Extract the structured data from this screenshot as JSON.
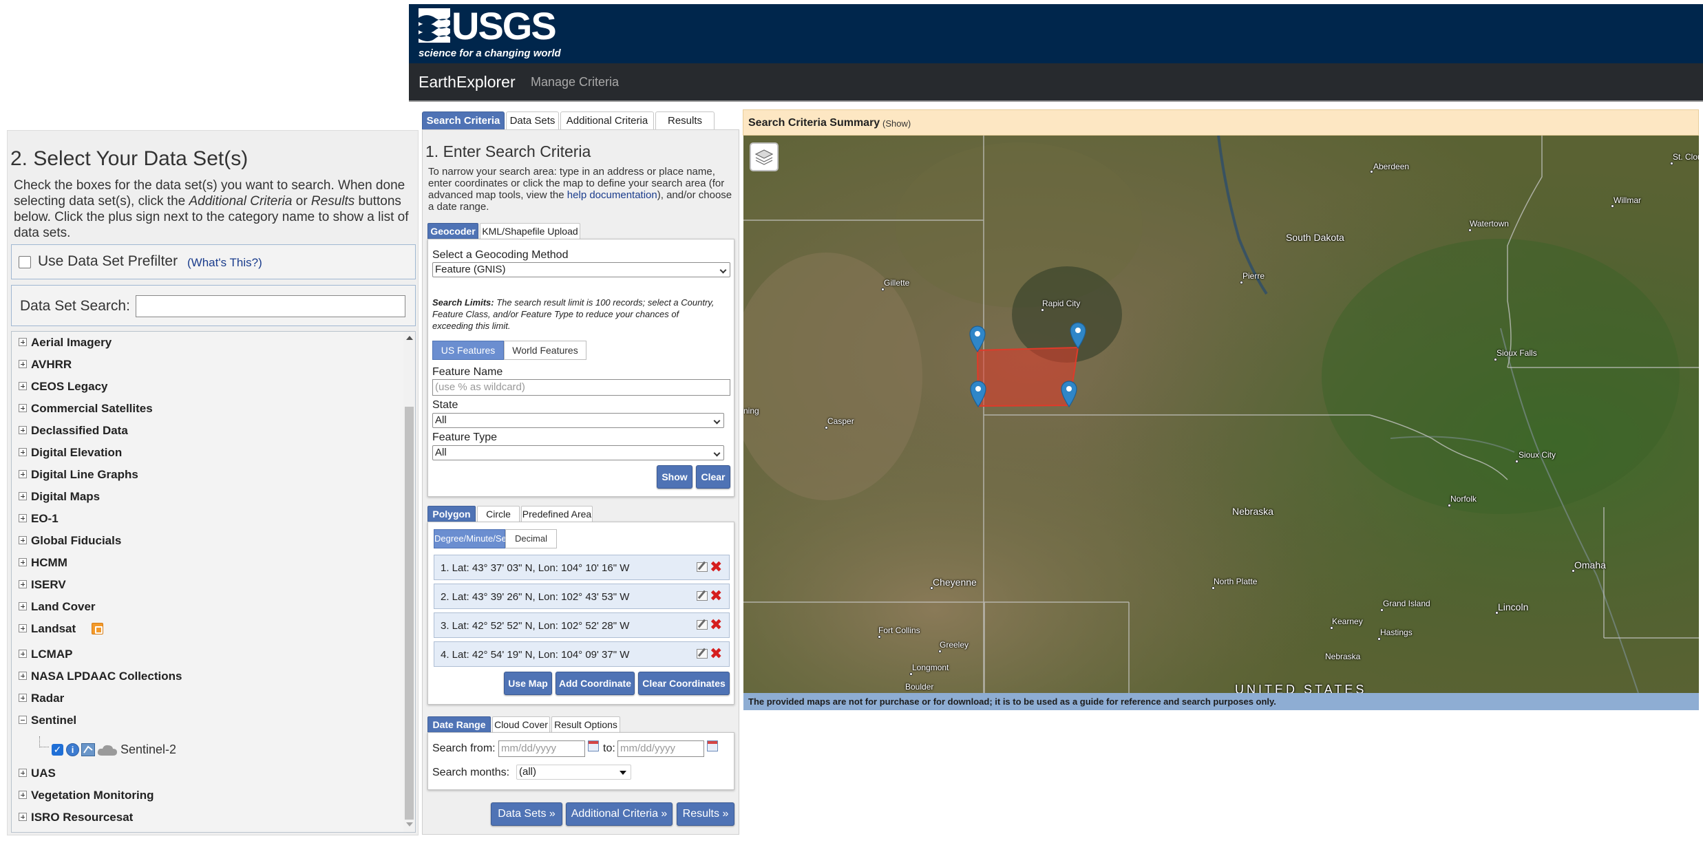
{
  "header": {
    "usgs_word": "USGS",
    "usgs_tagline": "science for a changing world",
    "app_name": "EarthExplorer",
    "manage_criteria": "Manage Criteria"
  },
  "main_tabs": [
    "Search Criteria",
    "Data Sets",
    "Additional Criteria",
    "Results"
  ],
  "datasets_panel": {
    "title": "2. Select Your Data Set(s)",
    "instructions_1": "Check the boxes for the data set(s) you want to search. When done selecting data set(s), click the ",
    "instructions_em1": "Additional Criteria",
    "instructions_2": " or ",
    "instructions_em2": "Results",
    "instructions_3": " buttons below. Click the plus sign next to the category name to show a list of data sets.",
    "prefilter_label": "Use Data Set Prefilter",
    "prefilter_link": "(What's This?)",
    "search_label": "Data Set Search:",
    "categories": [
      "Aerial Imagery",
      "AVHRR",
      "CEOS Legacy",
      "Commercial Satellites",
      "Declassified Data",
      "Digital Elevation",
      "Digital Line Graphs",
      "Digital Maps",
      "EO-1",
      "Global Fiducials",
      "HCMM",
      "ISERV",
      "Land Cover",
      "Landsat",
      "LCMAP",
      "NASA LPDAAC Collections",
      "Radar",
      "Sentinel",
      "UAS",
      "Vegetation Monitoring",
      "ISRO Resourcesat"
    ],
    "sentinel_child": "Sentinel-2"
  },
  "criteria": {
    "title": "1. Enter Search Criteria",
    "desc_1": "To narrow your search area: type in an address or place name, enter coordinates or click the map to define your search area (for advanced map tools, view the ",
    "desc_link": "help documentation",
    "desc_2": "), and/or choose a date range.",
    "geo_tabs": [
      "Geocoder",
      "KML/Shapefile Upload"
    ],
    "geocoding_method_label": "Select a Geocoding Method",
    "geocoding_method_value": "Feature (GNIS)",
    "search_limits_bold": "Search Limits:",
    "search_limits_text": " The search result limit is 100 records; select a Country, Feature Class, and/or Feature Type to reduce your chances of exceeding this limit.",
    "feature_toggle": [
      "US Features",
      "World Features"
    ],
    "feature_name_label": "Feature Name",
    "feature_name_placeholder": "(use % as wildcard)",
    "state_label": "State",
    "state_value": "All",
    "feature_type_label": "Feature Type",
    "feature_type_value": "All",
    "show_button": "Show",
    "clear_button": "Clear",
    "area_tabs": [
      "Polygon",
      "Circle",
      "Predefined Area"
    ],
    "coord_toggle": [
      "Degree/Minute/Second",
      "Decimal"
    ],
    "coordinates": [
      "1.  Lat: 43° 37' 03\" N, Lon: 104° 10' 16\" W",
      "2.  Lat: 43° 39' 26\" N, Lon: 102° 43' 53\" W",
      "3.  Lat: 42° 52' 52\" N, Lon: 102° 52' 28\" W",
      "4.  Lat: 42° 54' 19\" N, Lon: 104° 09' 37\" W"
    ],
    "use_map_button": "Use Map",
    "add_coordinate_button": "Add Coordinate",
    "clear_coordinates_button": "Clear Coordinates",
    "date_tabs": [
      "Date Range",
      "Cloud Cover",
      "Result Options"
    ],
    "search_from_label": "Search from:",
    "date_placeholder": "mm/dd/yyyy",
    "to_label": "to:",
    "search_months_label": "Search months:",
    "search_months_value": "(all)",
    "footer_buttons": [
      "Data Sets »",
      "Additional Criteria »",
      "Results »"
    ]
  },
  "map": {
    "summary_title": "Search Criteria Summary",
    "summary_show": "(Show)",
    "disclaimer": "The provided maps are not for purchase or for download; it is to be used as a guide for reference and search purposes only.",
    "labels": [
      "Aberdeen",
      "St. Clou",
      "Willmar",
      "Watertown",
      "South Dakota",
      "Pierre",
      "Gillette",
      "Rapid City",
      "Sioux Falls",
      "ning",
      "Casper",
      "Sioux City",
      "Norfolk",
      "Nebraska",
      "Omaha",
      "Cheyenne",
      "North Platte",
      "Grand Island",
      "Lincoln",
      "Kearney",
      "Hastings",
      "Fort Collins",
      "Greeley",
      "Longmont",
      "Boulder",
      "Nebraska",
      "UNITED STATES"
    ],
    "selection_color": "#e03a2a",
    "marker_color": "#2f86c8"
  }
}
